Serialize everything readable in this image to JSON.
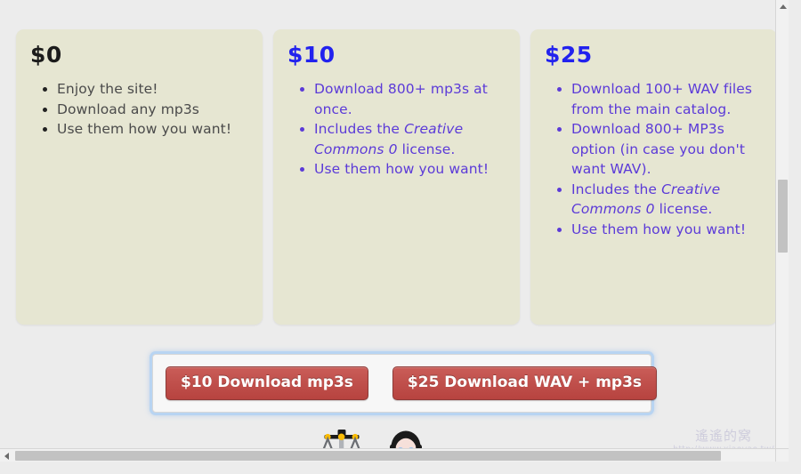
{
  "page": {
    "background_color": "#ececec"
  },
  "pricing": {
    "cards": [
      {
        "title": "$0",
        "title_color": "#1b1b1b",
        "text_color": "#4a4a4a",
        "items": [
          {
            "pre": "Enjoy the site!",
            "em": "",
            "post": ""
          },
          {
            "pre": "Download any mp3s",
            "em": "",
            "post": ""
          },
          {
            "pre": "Use them how you want!",
            "em": "",
            "post": ""
          }
        ]
      },
      {
        "title": "$10",
        "title_color": "#2222ee",
        "text_color": "#5b3ad8",
        "items": [
          {
            "pre": "Download 800+ mp3s at once.",
            "em": "",
            "post": ""
          },
          {
            "pre": "Includes the ",
            "em": "Creative Commons 0",
            "post": " license."
          },
          {
            "pre": "Use them how you want!",
            "em": "",
            "post": ""
          }
        ]
      },
      {
        "title": "$25",
        "title_color": "#2222ee",
        "text_color": "#5b3ad8",
        "items": [
          {
            "pre": "Download 100+ WAV files from the main catalog.",
            "em": "",
            "post": ""
          },
          {
            "pre": "Download 800+ MP3s option (in case you don't want WAV).",
            "em": "",
            "post": ""
          },
          {
            "pre": "Includes the ",
            "em": "Creative Commons 0",
            "post": " license."
          },
          {
            "pre": "Use them how you want!",
            "em": "",
            "post": ""
          }
        ]
      }
    ]
  },
  "purchase": {
    "buttons": [
      {
        "label": "$10 Download mp3s"
      },
      {
        "label": "$25 Download WAV + mp3s"
      }
    ],
    "button_color": "#c0504c",
    "focus_ring_color": "#b8d4f2"
  },
  "footer": {
    "emojis": [
      {
        "name": "balance-scale-emoji",
        "glyph": "⚖️"
      },
      {
        "name": "person-emoji",
        "glyph": "👧"
      }
    ],
    "watermark": {
      "logo": "遙遙的窝",
      "url": "http://www.xiaoyao.tw/"
    }
  },
  "scrollbars": {
    "vertical": {
      "thumb_top_pct": 39,
      "thumb_height_pct": 16
    },
    "horizontal": {
      "thumb_left_pct": 2,
      "thumb_width_pct": 90
    }
  }
}
